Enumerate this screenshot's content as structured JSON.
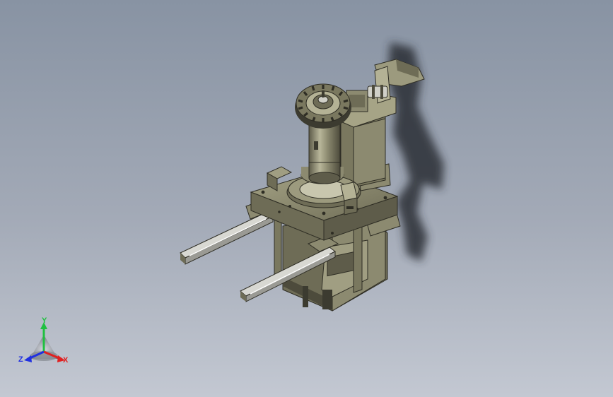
{
  "viewport": {
    "background_top": "#8893a3",
    "background_bottom": "#c3c8d2"
  },
  "model": {
    "body_color": "#8c8a70",
    "body_dark": "#5e5c4a",
    "body_light": "#b4b295",
    "rail_color": "#d8d8d2",
    "shadow_color": "#2a2e34"
  },
  "triad": {
    "x_label": "X",
    "y_label": "Y",
    "z_label": "Z",
    "x_color": "#e02020",
    "y_color": "#20c040",
    "z_color": "#2030e0"
  }
}
